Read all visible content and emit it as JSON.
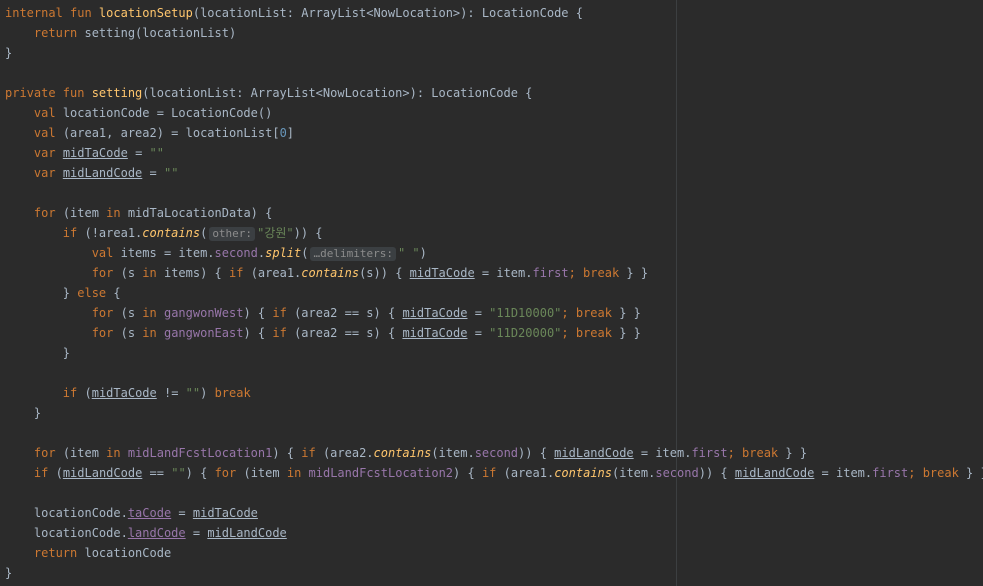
{
  "code": {
    "hint_other": "other:",
    "hint_delims": "…delimiters:",
    "str_gangwon": "\"강원\"",
    "str_space": "\" \"",
    "str_empty": "\"\"",
    "str_11D10000": "\"11D10000\"",
    "str_11D20000": "\"11D20000\"",
    "num_zero": "0"
  },
  "colors": {
    "background": "#2b2b2b",
    "keyword": "#cc7832",
    "function": "#ffc66d",
    "string": "#6a8759",
    "number": "#6897bb",
    "property": "#9876aa",
    "text": "#a9b7c6"
  }
}
